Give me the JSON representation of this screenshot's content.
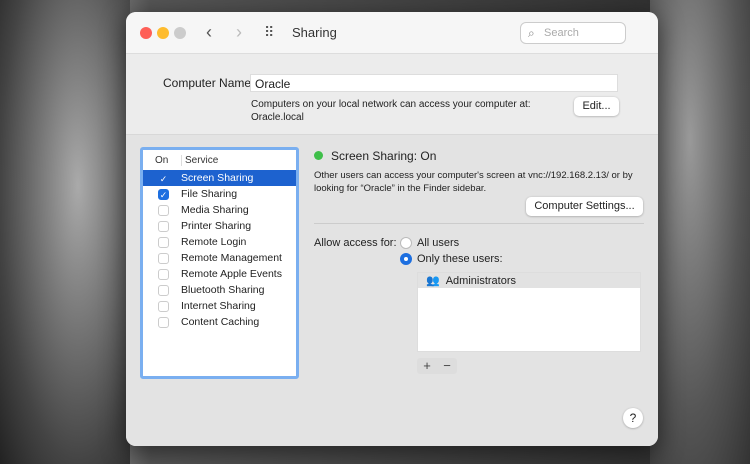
{
  "window": {
    "title": "Sharing",
    "search_placeholder": "Search"
  },
  "computer_name": {
    "label": "Computer Name:",
    "value": "Oracle",
    "note_line1": "Computers on your local network can access your computer at:",
    "note_line2": "Oracle.local",
    "edit_button": "Edit..."
  },
  "services": {
    "col_on": "On",
    "col_service": "Service",
    "items": [
      {
        "label": "Screen Sharing",
        "checked": true,
        "selected": true
      },
      {
        "label": "File Sharing",
        "checked": true
      },
      {
        "label": "Media Sharing",
        "checked": false
      },
      {
        "label": "Printer Sharing",
        "checked": false
      },
      {
        "label": "Remote Login",
        "checked": false
      },
      {
        "label": "Remote Management",
        "checked": false
      },
      {
        "label": "Remote Apple Events",
        "checked": false
      },
      {
        "label": "Bluetooth Sharing",
        "checked": false
      },
      {
        "label": "Internet Sharing",
        "checked": false
      },
      {
        "label": "Content Caching",
        "checked": false
      }
    ]
  },
  "detail": {
    "status": "Screen Sharing: On",
    "status_color": "#3fbf4a",
    "description": "Other users can access your computer's screen at vnc://192.168.2.13/ or by looking for “Oracle” in the Finder sidebar.",
    "settings_button": "Computer Settings...",
    "allow_label": "Allow access for:",
    "opt_all": "All users",
    "opt_only": "Only these users:",
    "users": [
      "Administrators"
    ],
    "add": "+",
    "remove": "−"
  },
  "help": "?"
}
